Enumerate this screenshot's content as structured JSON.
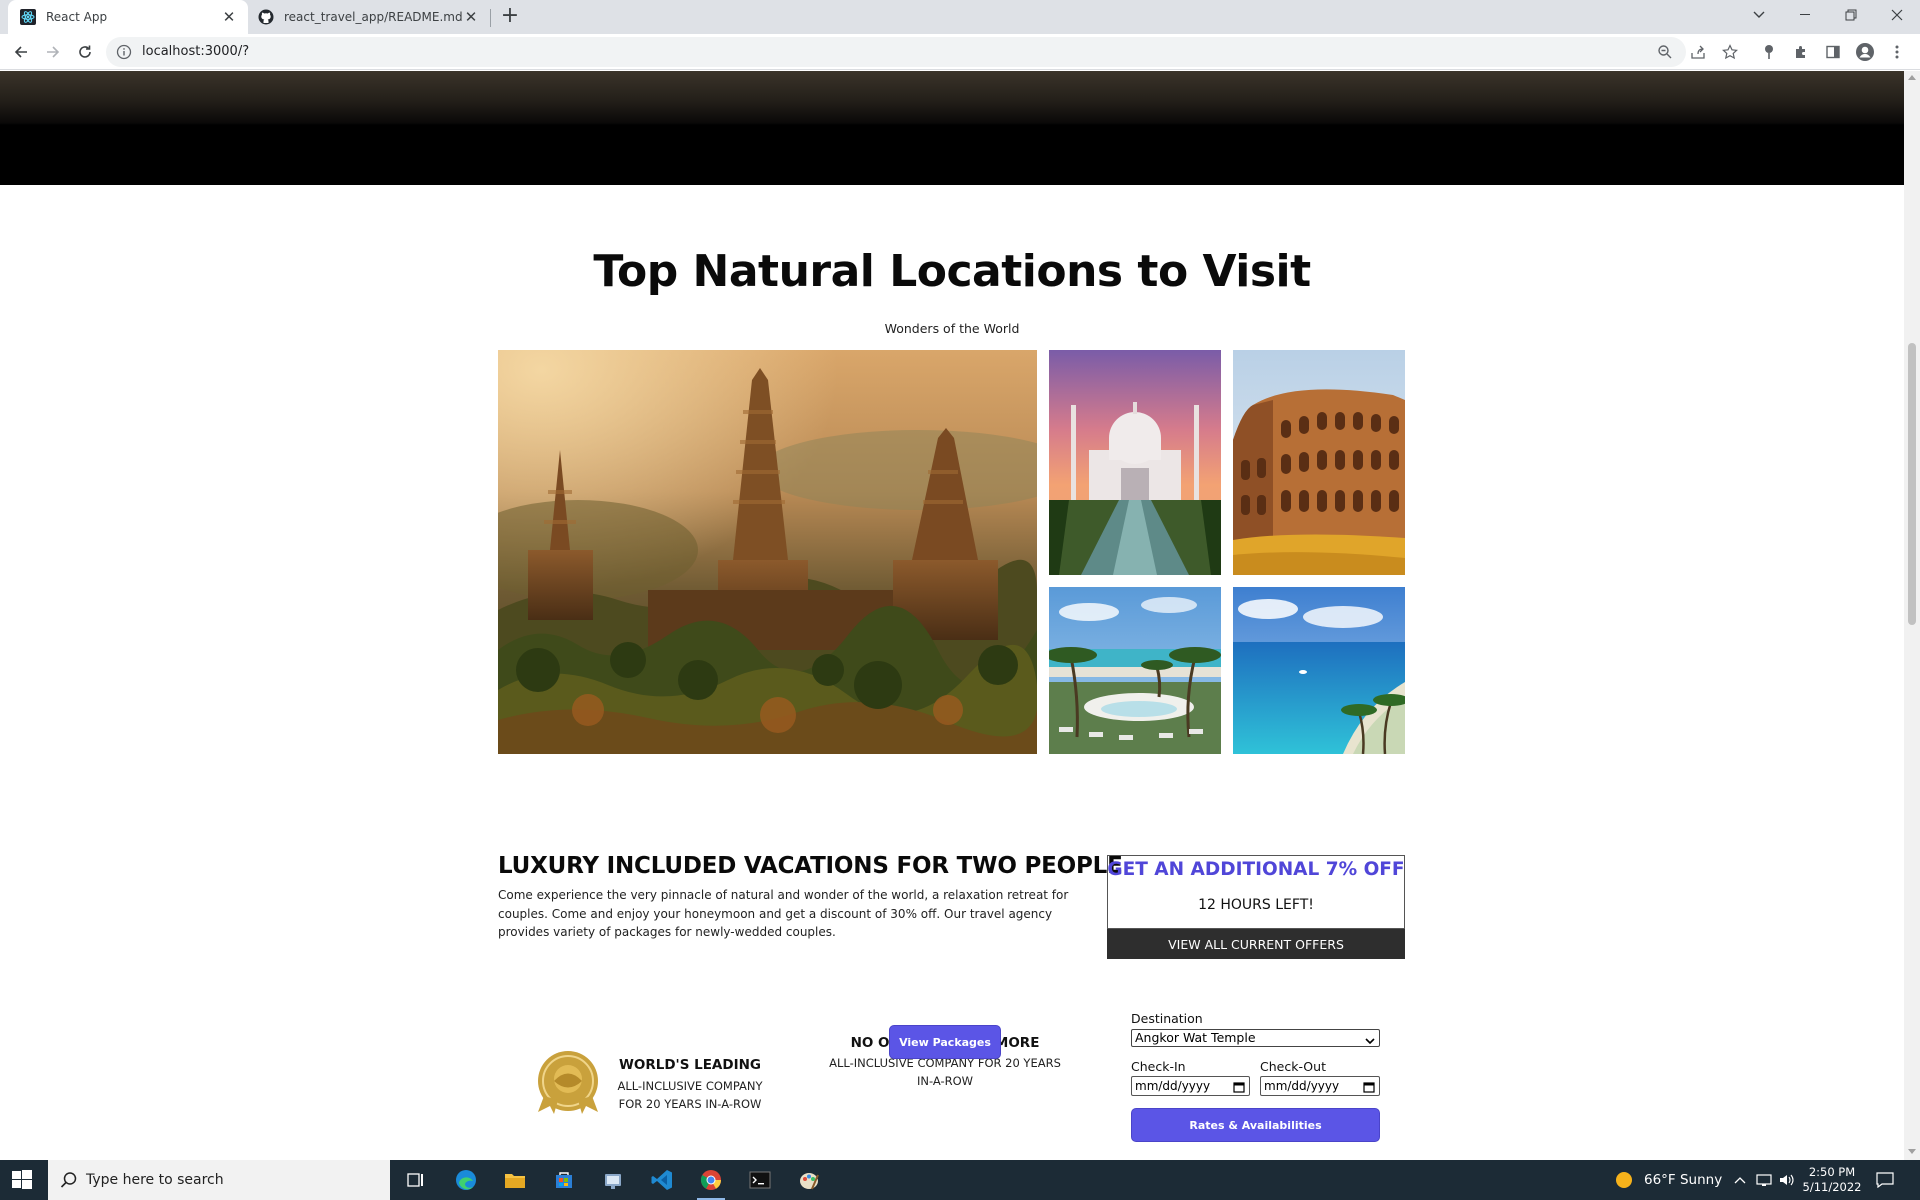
{
  "browser": {
    "tabs": [
      {
        "title": "React App",
        "active": true
      },
      {
        "title": "react_travel_app/README.md at"
      }
    ],
    "url": "localhost:3000/?"
  },
  "page": {
    "section_title": "Top Natural Locations to Visit",
    "section_subtitle": "Wonders of the World",
    "gallery": [
      {
        "name": "angkor-wat-photo"
      },
      {
        "name": "taj-mahal-photo"
      },
      {
        "name": "colosseum-photo"
      },
      {
        "name": "tropical-resort-photo"
      },
      {
        "name": "tropical-beach-photo"
      }
    ],
    "luxury": {
      "title": "LUXURY INCLUDED VACATIONS FOR TWO PEOPLE",
      "text": "Come experience the very pinnacle of natural and wonder of the world, a relaxation retreat for couples. Come and enjoy your honeymoon and get a discount of 30% off. Our travel agency provides variety of packages for newly-wedded couples."
    },
    "award": {
      "title": "WORLD'S LEADING",
      "line1": "ALL-INCLUSIVE COMPANY",
      "line2": "FOR 20 YEARS IN-A-ROW"
    },
    "no_one": {
      "title": "NO ONE INCLUDES MORE",
      "line1": "ALL-INCLUSIVE COMPANY FOR 20 YEARS",
      "line2": "IN-A-ROW",
      "button": "View Packages"
    },
    "offer": {
      "title": "GET AN ADDITIONAL 7% OFF",
      "subtitle": "12 HOURS LEFT!",
      "bar": "VIEW ALL CURRENT OFFERS"
    },
    "booking": {
      "destination_label": "Destination",
      "destination_value": "Angkor Wat Temple",
      "checkin_label": "Check-In",
      "checkout_label": "Check-Out",
      "date_placeholder": "mm/dd/yyyy",
      "button": "Rates & Availabilities"
    }
  },
  "taskbar": {
    "search_placeholder": "Type here to search",
    "weather": "66°F  Sunny",
    "time": "2:50 PM",
    "date": "5/11/2022"
  },
  "colors": {
    "accent": "#5b55e6",
    "offer_title": "#5046d8",
    "offer_bar": "#2e2e2e",
    "taskbar": "#1c2b36"
  }
}
